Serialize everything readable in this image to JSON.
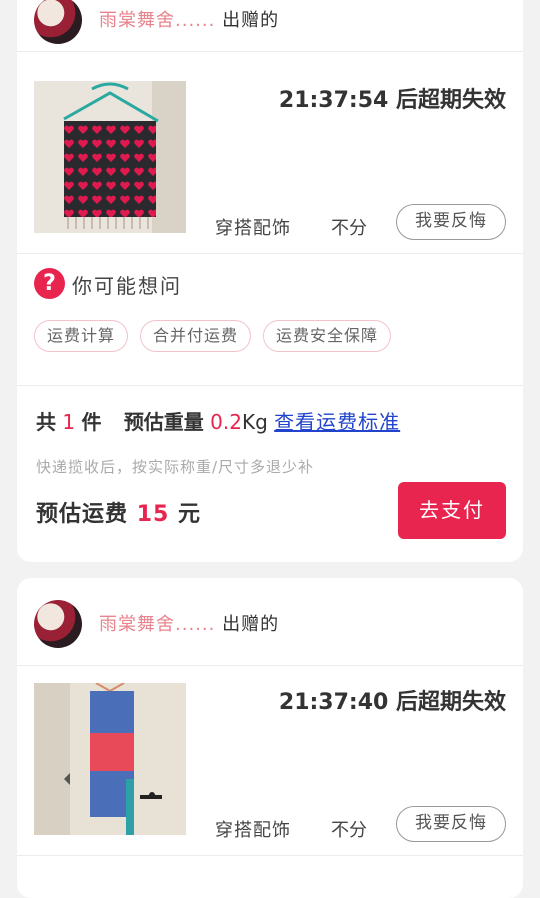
{
  "orders": [
    {
      "seller": {
        "name": "雨棠舞舍......",
        "suffix": "出赠的"
      },
      "expire_text": "21:37:54 后超期失效",
      "category": "穿搭配饰",
      "size": "不分",
      "regret_label": "我要反悔",
      "thumbnail_icon": "scarf-heart-pattern-image"
    },
    {
      "seller": {
        "name": "雨棠舞舍......",
        "suffix": "出赠的"
      },
      "expire_text": "21:37:40 后超期失效",
      "category": "穿搭配饰",
      "size": "不分",
      "regret_label": "我要反悔",
      "thumbnail_icon": "scarf-stripe-image"
    }
  ],
  "faq": {
    "icon": "question-icon",
    "icon_glyph": "?",
    "title": "你可能想问",
    "chips": [
      "运费计算",
      "合并付运费",
      "运费安全保障"
    ]
  },
  "shipping": {
    "count_prefix": "共",
    "count": "1",
    "count_suffix": "件",
    "weight_label": "预估重量",
    "weight_value": "0.2",
    "weight_unit": "Kg",
    "standard_link": "查看运费标准",
    "note": "快递揽收后，按实际称重/尺寸多退少补",
    "fee_label": "预估运费",
    "fee_value": "15",
    "fee_unit": "元",
    "pay_label": "去支付"
  },
  "colors": {
    "accent": "#e8254f",
    "seller_name": "#e8848e",
    "link": "#2244cc",
    "background": "#f2f2f2"
  }
}
